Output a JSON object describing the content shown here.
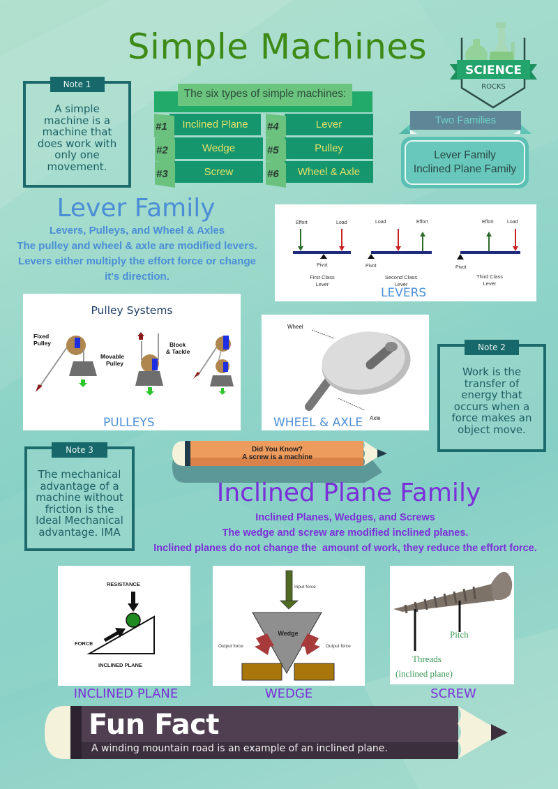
{
  "title": "Simple Machines",
  "badge": {
    "line1": "SCIENCE",
    "line2": "ROCKS"
  },
  "notes": [
    {
      "label": "Note 1",
      "text": "A simple machine is a machine that does work with only one movement."
    },
    {
      "label": "Note 2",
      "text": "Work is the transfer of energy that occurs when a force makes an object move."
    },
    {
      "label": "Note 3",
      "text": "The mechanical advantage of a machine without friction is the Ideal Mechanical advantage. IMA"
    }
  ],
  "six_types": {
    "header": "The six types of simple machines:",
    "items": [
      {
        "num": "#1",
        "label": "Inclined Plane"
      },
      {
        "num": "#2",
        "label": "Wedge"
      },
      {
        "num": "#3",
        "label": "Screw"
      },
      {
        "num": "#4",
        "label": "Lever"
      },
      {
        "num": "#5",
        "label": "Pulley"
      },
      {
        "num": "#6",
        "label": "Wheel & Axle"
      }
    ]
  },
  "families": {
    "banner": "Two Families",
    "items": [
      "Lever Family",
      "Inclined Plane Family"
    ]
  },
  "lever_family": {
    "title": "Lever Family",
    "lines": [
      "Levers, Pulleys, and Wheel & Axles",
      "The pulley and wheel & axle are modified levers.",
      "Levers either multiply the effort force or change it's direction."
    ]
  },
  "levers_panel": {
    "caption": "LEVERS",
    "labels": {
      "effort": "Effort",
      "load": "Load",
      "pivot": "Pivot"
    },
    "classes": [
      "First Class Lever",
      "Second Class Lever",
      "Third Class Lever"
    ]
  },
  "pulleys_panel": {
    "heading": "Pulley Systems",
    "caption": "PULLEYS",
    "labels": [
      "Fixed Pulley",
      "Movable Pulley",
      "Block & Tackle"
    ]
  },
  "wheel_panel": {
    "caption": "WHEEL & AXLE",
    "labels": {
      "wheel": "Wheel",
      "axle": "Axle"
    }
  },
  "did_you_know": {
    "line1": "Did You Know?",
    "line2": "A screw is a machine"
  },
  "inclined_family": {
    "title": "Inclined Plane Family",
    "lines": [
      "Inclined Planes, Wedges, and Screws",
      "The wedge and screw are modified inclined planes.",
      "Inclined planes do not change the  amount of work, they reduce the effort force."
    ]
  },
  "inclined_panel": {
    "caption": "INCLINED PLANE",
    "labels": {
      "resistance": "RESISTANCE",
      "force": "FORCE",
      "plane": "INCLINED PLANE"
    }
  },
  "wedge_panel": {
    "caption": "WEDGE",
    "labels": {
      "input": "Input force",
      "wedge": "Wedge",
      "output_left": "Output force",
      "output_right": "Output force"
    }
  },
  "screw_panel": {
    "caption": "SCREW",
    "labels": {
      "pitch": "Pitch",
      "threads": "Threads",
      "threads_note": "(inclined plane)"
    }
  },
  "fun_fact": {
    "title": "Fun Fact",
    "text": "A winding mountain road is an example of an inclined plane."
  },
  "colors": {
    "title_green": "#3e8a16",
    "lever_blue": "#4b8ed6",
    "inclined_purple": "#7b2fd8",
    "note_teal": "#1c6a6b"
  }
}
